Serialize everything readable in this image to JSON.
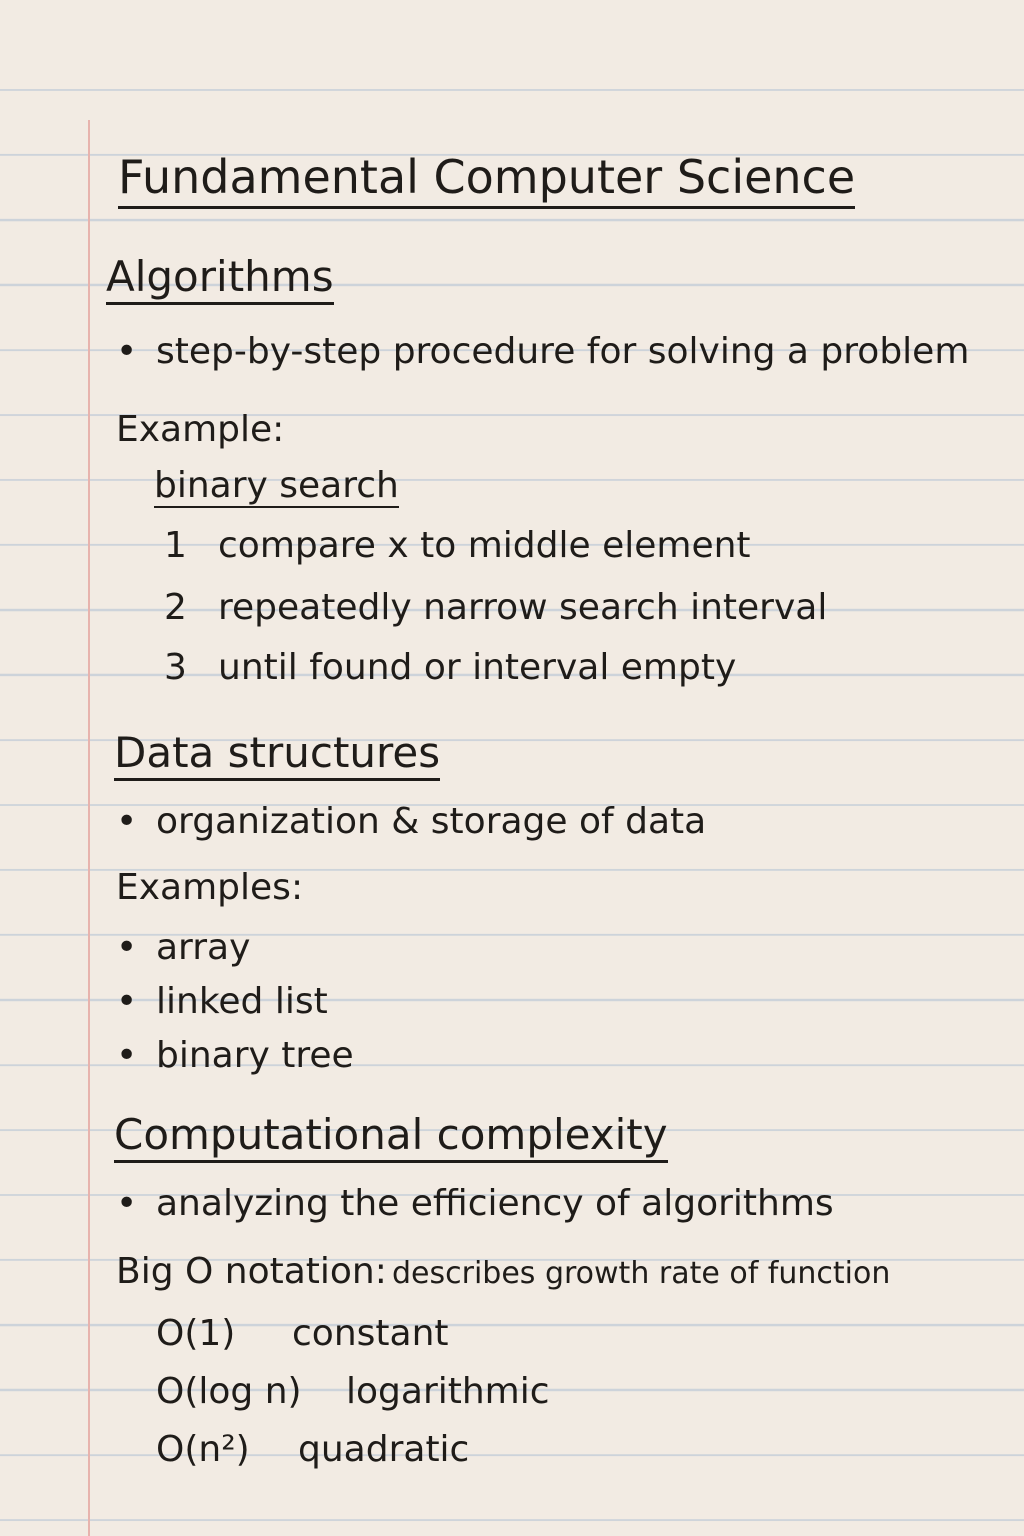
{
  "title": "Fundamental Computer Science",
  "algorithms": {
    "heading": "Algorithms",
    "bullet": "step-by-step procedure for solving a problem",
    "example_label": "Example:",
    "example_name": "binary search",
    "steps": [
      {
        "n": "1",
        "text": "compare x to middle element"
      },
      {
        "n": "2",
        "text": "repeatedly narrow search interval"
      },
      {
        "n": "3",
        "text": "until found or interval empty"
      }
    ]
  },
  "data_structures": {
    "heading": "Data structures",
    "bullet": "organization & storage of data",
    "examples_label": "Examples:",
    "examples": [
      "array",
      "linked list",
      "binary tree"
    ]
  },
  "complexity": {
    "heading": "Computational complexity",
    "bullet": "analyzing the efficiency of algorithms",
    "bigo_label": "Big O notation:",
    "bigo_desc": "describes growth rate of function",
    "orders": [
      {
        "notation": "O(1)",
        "name": "constant"
      },
      {
        "notation": "O(log n)",
        "name": "logarithmic"
      },
      {
        "notation": "O(n²)",
        "name": "quadratic"
      }
    ]
  }
}
